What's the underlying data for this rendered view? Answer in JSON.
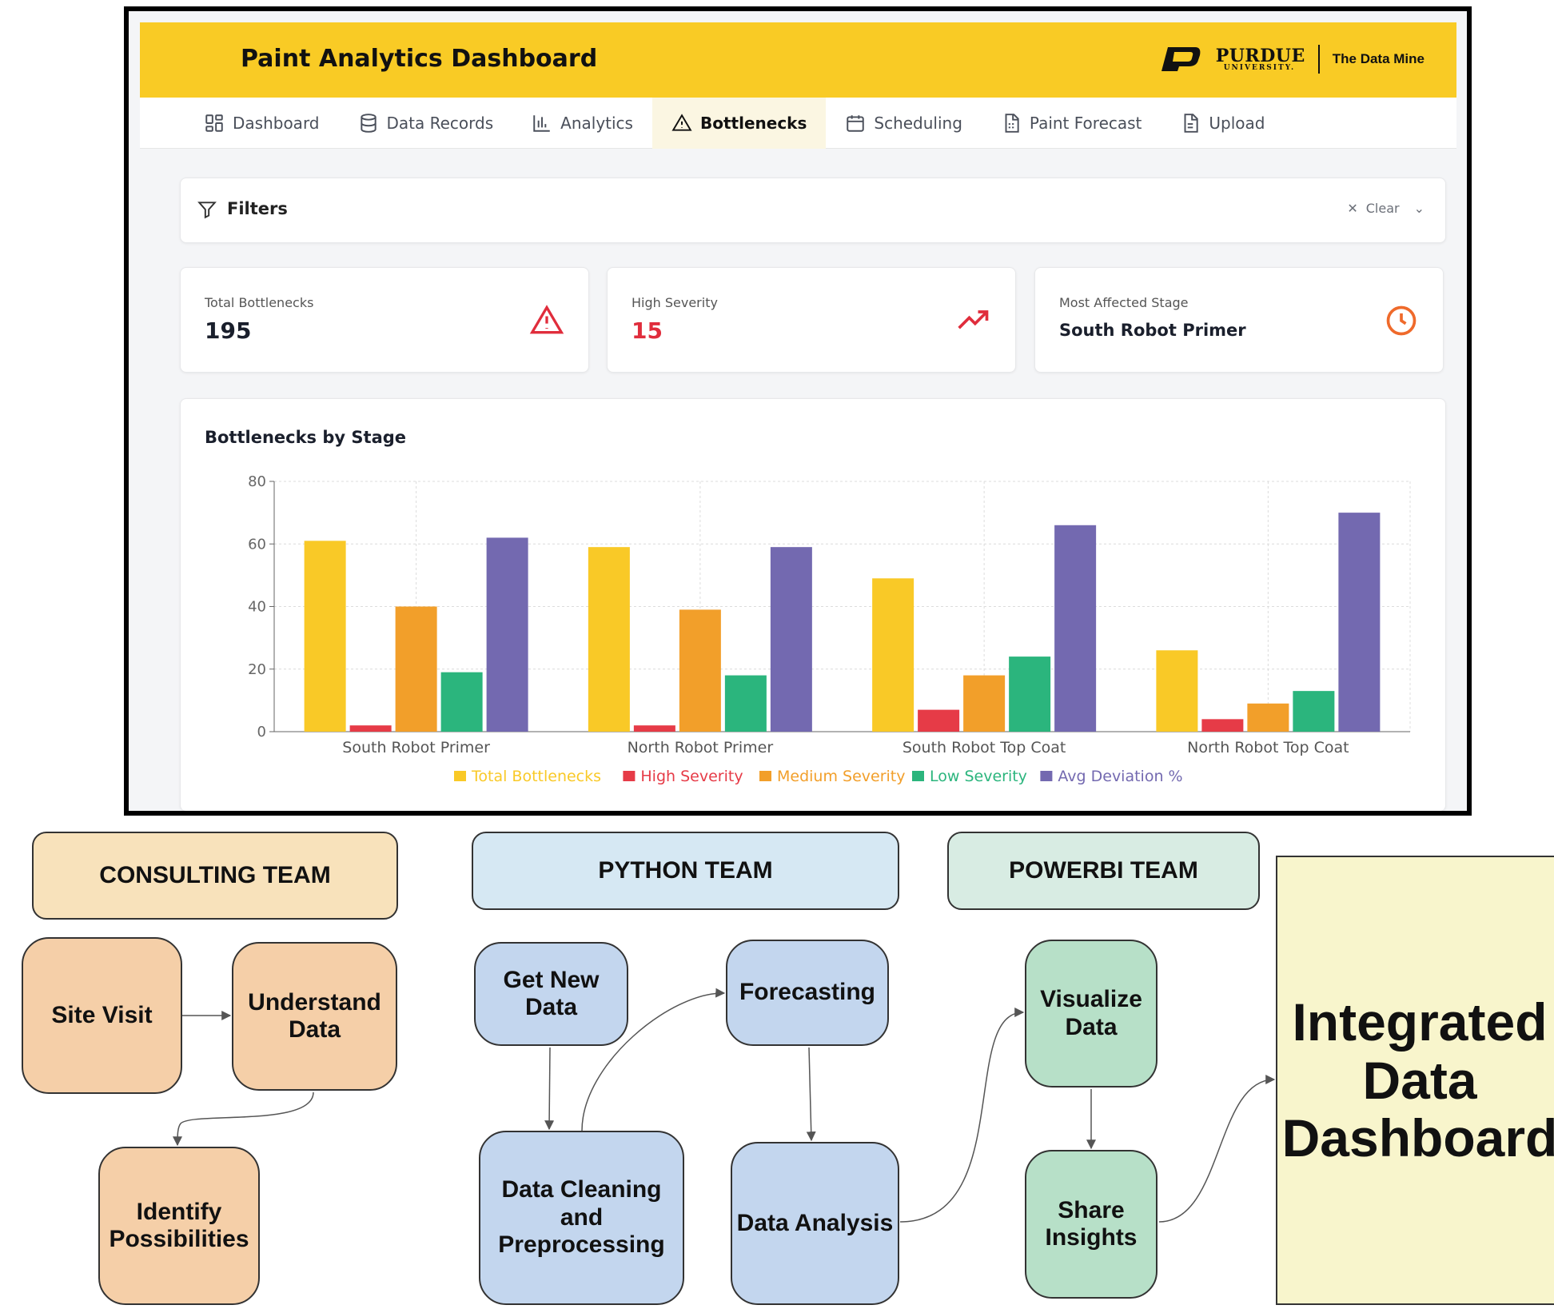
{
  "dashboard": {
    "title": "Paint Analytics Dashboard",
    "logo": {
      "university": "PURDUE",
      "university_small": "UNIVERSITY.",
      "partner": "The Data Mine"
    },
    "brand_color": "#f9cb25",
    "tabs": [
      {
        "label": "Dashboard",
        "icon": "grid-icon"
      },
      {
        "label": "Data Records",
        "icon": "database-icon"
      },
      {
        "label": "Analytics",
        "icon": "bar-chart-icon"
      },
      {
        "label": "Bottlenecks",
        "icon": "warning-icon",
        "active": true
      },
      {
        "label": "Scheduling",
        "icon": "calendar-icon"
      },
      {
        "label": "Paint Forecast",
        "icon": "document-icon"
      },
      {
        "label": "Upload",
        "icon": "file-icon"
      }
    ],
    "filters": {
      "title": "Filters",
      "clear_label": "Clear"
    },
    "stats": [
      {
        "label": "Total Bottlenecks",
        "value": "195",
        "icon": "alert-triangle-icon",
        "color": "#1a1f2c"
      },
      {
        "label": "High Severity",
        "value": "15",
        "icon": "trending-up-icon",
        "color": "#e02d3c"
      },
      {
        "label": "Most Affected Stage",
        "value": "South Robot Primer",
        "icon": "clock-icon",
        "color": "#1a1f2c"
      }
    ],
    "chart_title": "Bottlenecks by Stage"
  },
  "chart_data": {
    "type": "bar",
    "title": "Bottlenecks by Stage",
    "categories": [
      "South Robot Primer",
      "North Robot Primer",
      "South Robot Top Coat",
      "North Robot Top Coat"
    ],
    "series": [
      {
        "name": "Total Bottlenecks",
        "color": "#f9c927",
        "values": [
          61,
          59,
          49,
          26
        ]
      },
      {
        "name": "High Severity",
        "color": "#e63b47",
        "values": [
          2,
          2,
          7,
          4
        ]
      },
      {
        "name": "Medium Severity",
        "color": "#f29f2a",
        "values": [
          40,
          39,
          18,
          9
        ]
      },
      {
        "name": "Low Severity",
        "color": "#2bb57d",
        "values": [
          19,
          18,
          24,
          13
        ]
      },
      {
        "name": "Avg Deviation %",
        "color": "#7369b0",
        "values": [
          62,
          59,
          66,
          70
        ]
      }
    ],
    "yticks": [
      0,
      20,
      40,
      60,
      80
    ],
    "ylim": [
      0,
      80
    ],
    "grid": true,
    "legend": "bottom"
  },
  "flow": {
    "teams": [
      {
        "name": "CONSULTING TEAM",
        "color": "#f8e2bb"
      },
      {
        "name": "PYTHON TEAM",
        "color": "#d6e8f3"
      },
      {
        "name": "POWERBI TEAM",
        "color": "#d8ece3"
      }
    ],
    "consulting_steps": [
      "Site Visit",
      "Understand Data",
      "Identify Possibilities"
    ],
    "python_steps": [
      "Get New Data",
      "Forecasting",
      "Data Cleaning and Preprocessing",
      "Data Analysis"
    ],
    "powerbi_steps": [
      "Visualize Data",
      "Share Insights"
    ],
    "final": "Integrated Data Dashboard",
    "colors": {
      "consulting_step": "#f5cfa8",
      "python_step": "#c3d6ee",
      "powerbi_step": "#b7e0c8",
      "final": "#f8f5cc"
    }
  }
}
